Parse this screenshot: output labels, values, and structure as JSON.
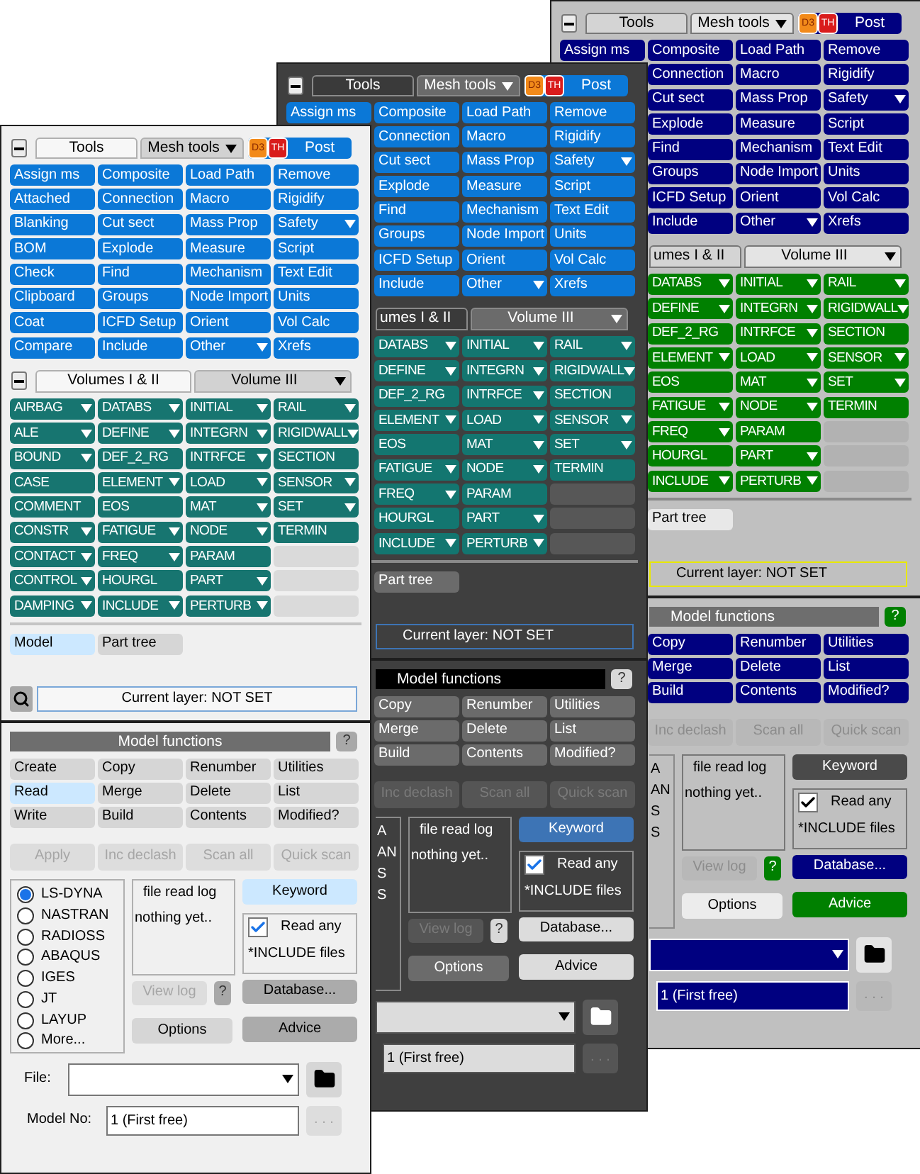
{
  "panels": [
    {
      "kind": "classic",
      "tabs": [
        {
          "label": "Tools",
          "selected": true,
          "menu": false
        },
        {
          "label": "Mesh tools",
          "selected": false,
          "menu": true
        }
      ],
      "logo": [
        "D3",
        "TH"
      ],
      "post": "Post",
      "tools": [
        [
          {
            "label": "Assign ms",
            "kind": "button"
          },
          {
            "label": "Composite",
            "kind": "button"
          },
          {
            "label": "Load Path",
            "kind": "button"
          },
          {
            "label": "Remove",
            "kind": "button"
          }
        ],
        [
          {
            "label": "Connection",
            "kind": "button"
          },
          {
            "label": "Macro",
            "kind": "button"
          },
          {
            "label": "Rigidify",
            "kind": "button"
          }
        ],
        [
          {
            "label": "Cut sect",
            "kind": "button"
          },
          {
            "label": "Mass Prop",
            "kind": "button"
          },
          {
            "label": "Safety",
            "kind": "menu"
          }
        ],
        [
          {
            "label": "Explode",
            "kind": "button"
          },
          {
            "label": "Measure",
            "kind": "button"
          },
          {
            "label": "Script",
            "kind": "button"
          }
        ],
        [
          {
            "label": "Find",
            "kind": "button"
          },
          {
            "label": "Mechanism",
            "kind": "button"
          },
          {
            "label": "Text Edit",
            "kind": "button"
          }
        ],
        [
          {
            "label": "Groups",
            "kind": "button"
          },
          {
            "label": "Node Import",
            "kind": "button"
          },
          {
            "label": "Units",
            "kind": "button"
          }
        ],
        [
          {
            "label": "ICFD Setup",
            "kind": "button"
          },
          {
            "label": "Orient",
            "kind": "button"
          },
          {
            "label": "Vol Calc",
            "kind": "button"
          }
        ],
        [
          {
            "label": "Include",
            "kind": "button"
          },
          {
            "label": "Other",
            "kind": "menu"
          },
          {
            "label": "Xrefs",
            "kind": "button"
          }
        ]
      ],
      "volume_tabs": [
        {
          "label": "umes I & II",
          "selected": true,
          "cut": true,
          "menu": false
        },
        {
          "label": "Volume III",
          "selected": false,
          "cut": false,
          "menu": true
        }
      ],
      "volumes": [
        [
          {
            "label": "DATABS",
            "kind": "menu"
          },
          {
            "label": "INITIAL",
            "kind": "menu"
          },
          {
            "label": "RAIL",
            "kind": "menu"
          }
        ],
        [
          {
            "label": "DEFINE",
            "kind": "menu"
          },
          {
            "label": "INTEGRN",
            "kind": "menu"
          },
          {
            "label": "RIGIDWALL",
            "kind": "menu"
          }
        ],
        [
          {
            "label": "DEF_2_RG",
            "kind": "button"
          },
          {
            "label": "INTRFCE",
            "kind": "menu"
          },
          {
            "label": "SECTION",
            "kind": "button"
          }
        ],
        [
          {
            "label": "ELEMENT",
            "kind": "menu"
          },
          {
            "label": "LOAD",
            "kind": "menu"
          },
          {
            "label": "SENSOR",
            "kind": "menu"
          }
        ],
        [
          {
            "label": "EOS",
            "kind": "button"
          },
          {
            "label": "MAT",
            "kind": "menu"
          },
          {
            "label": "SET",
            "kind": "menu"
          }
        ],
        [
          {
            "label": "FATIGUE",
            "kind": "menu"
          },
          {
            "label": "NODE",
            "kind": "menu"
          },
          {
            "label": "TERMIN",
            "kind": "button"
          }
        ],
        [
          {
            "label": "FREQ",
            "kind": "menu"
          },
          {
            "label": "PARAM",
            "kind": "button"
          },
          {
            "kind": "blank"
          }
        ],
        [
          {
            "label": "HOURGL",
            "kind": "button"
          },
          {
            "label": "PART",
            "kind": "menu"
          },
          {
            "kind": "blank"
          }
        ],
        [
          {
            "label": "INCLUDE",
            "kind": "menu"
          },
          {
            "label": "PERTURB",
            "kind": "menu"
          },
          {
            "kind": "blank"
          }
        ]
      ],
      "modes": [
        {
          "label": "Part tree",
          "selected": false
        }
      ],
      "layer": {
        "text": "Current layer: NOT SET"
      },
      "header": {
        "title": "Model functions",
        "help": "?"
      },
      "functions": [
        [
          {
            "label": "Copy",
            "selected": false
          },
          {
            "label": "Renumber",
            "selected": false
          },
          {
            "label": "Utilities",
            "selected": false
          }
        ],
        [
          {
            "label": "Merge",
            "selected": false
          },
          {
            "label": "Delete",
            "selected": false
          },
          {
            "label": "List",
            "selected": false
          }
        ],
        [
          {
            "label": "Build",
            "selected": false
          },
          {
            "label": "Contents",
            "selected": false
          },
          {
            "label": "Modified?",
            "selected": false
          }
        ]
      ],
      "actions": [
        {
          "label": "Inc declash",
          "disabled": true
        },
        {
          "label": "Scan all",
          "disabled": true
        },
        {
          "label": "Quick scan",
          "disabled": true
        }
      ],
      "formats": {
        "cut": true,
        "items": [
          {
            "label": "A"
          },
          {
            "label": "AN"
          },
          {
            "label": "S"
          },
          {
            "label": "S"
          }
        ]
      },
      "log": {
        "title": "file read log",
        "text": "nothing yet.."
      },
      "keyword": {
        "label": "Keyword",
        "selected": true
      },
      "read_any": {
        "checked": true,
        "label": "Read any",
        "note": "*INCLUDE files"
      },
      "view_log": {
        "label": "View log",
        "disabled": true
      },
      "log_help": "?",
      "database": "Database...",
      "options": "Options",
      "advice": "Advice",
      "model_no": {
        "value": "1 (First free)",
        "more": ". . ."
      }
    },
    {
      "kind": "dark",
      "tabs": [
        {
          "label": "Tools",
          "selected": true,
          "menu": false
        },
        {
          "label": "Mesh tools",
          "selected": false,
          "menu": true
        }
      ],
      "logo": [
        "D3",
        "TH"
      ],
      "post": "Post",
      "tools": [
        [
          {
            "label": "Assign ms",
            "kind": "button"
          },
          {
            "label": "Composite",
            "kind": "button"
          },
          {
            "label": "Load Path",
            "kind": "button"
          },
          {
            "label": "Remove",
            "kind": "button"
          }
        ],
        [
          {
            "label": "Connection",
            "kind": "button"
          },
          {
            "label": "Macro",
            "kind": "button"
          },
          {
            "label": "Rigidify",
            "kind": "button"
          }
        ],
        [
          {
            "label": "Cut sect",
            "kind": "button"
          },
          {
            "label": "Mass Prop",
            "kind": "button"
          },
          {
            "label": "Safety",
            "kind": "menu"
          }
        ],
        [
          {
            "label": "Explode",
            "kind": "button"
          },
          {
            "label": "Measure",
            "kind": "button"
          },
          {
            "label": "Script",
            "kind": "button"
          }
        ],
        [
          {
            "label": "Find",
            "kind": "button"
          },
          {
            "label": "Mechanism",
            "kind": "button"
          },
          {
            "label": "Text Edit",
            "kind": "button"
          }
        ],
        [
          {
            "label": "Groups",
            "kind": "button"
          },
          {
            "label": "Node Import",
            "kind": "button"
          },
          {
            "label": "Units",
            "kind": "button"
          }
        ],
        [
          {
            "label": "ICFD Setup",
            "kind": "button"
          },
          {
            "label": "Orient",
            "kind": "button"
          },
          {
            "label": "Vol Calc",
            "kind": "button"
          }
        ],
        [
          {
            "label": "Include",
            "kind": "button"
          },
          {
            "label": "Other",
            "kind": "menu"
          },
          {
            "label": "Xrefs",
            "kind": "button"
          }
        ]
      ],
      "volume_tabs": [
        {
          "label": "umes I & II",
          "selected": true,
          "cut": true,
          "menu": false
        },
        {
          "label": "Volume III",
          "selected": false,
          "cut": false,
          "menu": true
        }
      ],
      "volumes": [
        [
          {
            "label": "DATABS",
            "kind": "menu"
          },
          {
            "label": "INITIAL",
            "kind": "menu"
          },
          {
            "label": "RAIL",
            "kind": "menu"
          }
        ],
        [
          {
            "label": "DEFINE",
            "kind": "menu"
          },
          {
            "label": "INTEGRN",
            "kind": "menu"
          },
          {
            "label": "RIGIDWALL",
            "kind": "menu"
          }
        ],
        [
          {
            "label": "DEF_2_RG",
            "kind": "button"
          },
          {
            "label": "INTRFCE",
            "kind": "menu"
          },
          {
            "label": "SECTION",
            "kind": "button"
          }
        ],
        [
          {
            "label": "ELEMENT",
            "kind": "menu"
          },
          {
            "label": "LOAD",
            "kind": "menu"
          },
          {
            "label": "SENSOR",
            "kind": "menu"
          }
        ],
        [
          {
            "label": "EOS",
            "kind": "button"
          },
          {
            "label": "MAT",
            "kind": "menu"
          },
          {
            "label": "SET",
            "kind": "menu"
          }
        ],
        [
          {
            "label": "FATIGUE",
            "kind": "menu"
          },
          {
            "label": "NODE",
            "kind": "menu"
          },
          {
            "label": "TERMIN",
            "kind": "button"
          }
        ],
        [
          {
            "label": "FREQ",
            "kind": "menu"
          },
          {
            "label": "PARAM",
            "kind": "button"
          },
          {
            "kind": "blank"
          }
        ],
        [
          {
            "label": "HOURGL",
            "kind": "button"
          },
          {
            "label": "PART",
            "kind": "menu"
          },
          {
            "kind": "blank"
          }
        ],
        [
          {
            "label": "INCLUDE",
            "kind": "menu"
          },
          {
            "label": "PERTURB",
            "kind": "menu"
          },
          {
            "kind": "blank"
          }
        ]
      ],
      "modes": [
        {
          "label": "Part tree",
          "selected": false
        }
      ],
      "layer": {
        "text": "Current layer: NOT SET"
      },
      "header": {
        "title": "Model functions",
        "help": "?"
      },
      "functions": [
        [
          {
            "label": "Copy",
            "selected": false
          },
          {
            "label": "Renumber",
            "selected": false
          },
          {
            "label": "Utilities",
            "selected": false
          }
        ],
        [
          {
            "label": "Merge",
            "selected": false
          },
          {
            "label": "Delete",
            "selected": false
          },
          {
            "label": "List",
            "selected": false
          }
        ],
        [
          {
            "label": "Build",
            "selected": false
          },
          {
            "label": "Contents",
            "selected": false
          },
          {
            "label": "Modified?",
            "selected": false
          }
        ]
      ],
      "actions": [
        {
          "label": "Inc declash",
          "disabled": true
        },
        {
          "label": "Scan all",
          "disabled": true
        },
        {
          "label": "Quick scan",
          "disabled": true
        }
      ],
      "formats": {
        "cut": true,
        "items": [
          {
            "label": "A"
          },
          {
            "label": "AN"
          },
          {
            "label": "S"
          },
          {
            "label": "S"
          }
        ]
      },
      "log": {
        "title": "file read log",
        "text": "nothing yet.."
      },
      "keyword": {
        "label": "Keyword",
        "selected": true
      },
      "read_any": {
        "checked": true,
        "label": "Read any",
        "note": "*INCLUDE files"
      },
      "view_log": {
        "label": "View log",
        "disabled": true
      },
      "log_help": "?",
      "database": "Database...",
      "options": "Options",
      "advice": "Advice",
      "model_no": {
        "value": "1 (First free)",
        "more": ". . ."
      }
    },
    {
      "kind": "light",
      "tabs": [
        {
          "label": "Tools",
          "selected": true,
          "menu": false
        },
        {
          "label": "Mesh tools",
          "selected": false,
          "menu": true
        }
      ],
      "logo": [
        "D3",
        "TH"
      ],
      "post": "Post",
      "tools": [
        [
          {
            "label": "Assign ms",
            "kind": "button"
          },
          {
            "label": "Composite",
            "kind": "button"
          },
          {
            "label": "Load Path",
            "kind": "button"
          },
          {
            "label": "Remove",
            "kind": "button"
          }
        ],
        [
          {
            "label": "Attached",
            "kind": "button"
          },
          {
            "label": "Connection",
            "kind": "button"
          },
          {
            "label": "Macro",
            "kind": "button"
          },
          {
            "label": "Rigidify",
            "kind": "button"
          }
        ],
        [
          {
            "label": "Blanking",
            "kind": "button"
          },
          {
            "label": "Cut sect",
            "kind": "button"
          },
          {
            "label": "Mass Prop",
            "kind": "button"
          },
          {
            "label": "Safety",
            "kind": "menu"
          }
        ],
        [
          {
            "label": "BOM",
            "kind": "button"
          },
          {
            "label": "Explode",
            "kind": "button"
          },
          {
            "label": "Measure",
            "kind": "button"
          },
          {
            "label": "Script",
            "kind": "button"
          }
        ],
        [
          {
            "label": "Check",
            "kind": "button"
          },
          {
            "label": "Find",
            "kind": "button"
          },
          {
            "label": "Mechanism",
            "kind": "button"
          },
          {
            "label": "Text Edit",
            "kind": "button"
          }
        ],
        [
          {
            "label": "Clipboard",
            "kind": "button"
          },
          {
            "label": "Groups",
            "kind": "button"
          },
          {
            "label": "Node Import",
            "kind": "button"
          },
          {
            "label": "Units",
            "kind": "button"
          }
        ],
        [
          {
            "label": "Coat",
            "kind": "button"
          },
          {
            "label": "ICFD Setup",
            "kind": "button"
          },
          {
            "label": "Orient",
            "kind": "button"
          },
          {
            "label": "Vol Calc",
            "kind": "button"
          }
        ],
        [
          {
            "label": "Compare",
            "kind": "button"
          },
          {
            "label": "Include",
            "kind": "button"
          },
          {
            "label": "Other",
            "kind": "menu"
          },
          {
            "label": "Xrefs",
            "kind": "button"
          }
        ]
      ],
      "volumes_toggle": true,
      "volume_tabs": [
        {
          "label": "Volumes I & II",
          "selected": true,
          "cut": false,
          "menu": false
        },
        {
          "label": "Volume III",
          "selected": false,
          "cut": false,
          "menu": true
        }
      ],
      "volumes": [
        [
          {
            "label": "AIRBAG",
            "kind": "menu"
          },
          {
            "label": "DATABS",
            "kind": "menu"
          },
          {
            "label": "INITIAL",
            "kind": "menu"
          },
          {
            "label": "RAIL",
            "kind": "menu"
          }
        ],
        [
          {
            "label": "ALE",
            "kind": "menu"
          },
          {
            "label": "DEFINE",
            "kind": "menu"
          },
          {
            "label": "INTEGRN",
            "kind": "menu"
          },
          {
            "label": "RIGIDWALL",
            "kind": "menu"
          }
        ],
        [
          {
            "label": "BOUND",
            "kind": "menu"
          },
          {
            "label": "DEF_2_RG",
            "kind": "button"
          },
          {
            "label": "INTRFCE",
            "kind": "menu"
          },
          {
            "label": "SECTION",
            "kind": "button"
          }
        ],
        [
          {
            "label": "CASE",
            "kind": "button"
          },
          {
            "label": "ELEMENT",
            "kind": "menu"
          },
          {
            "label": "LOAD",
            "kind": "menu"
          },
          {
            "label": "SENSOR",
            "kind": "menu"
          }
        ],
        [
          {
            "label": "COMMENT",
            "kind": "button"
          },
          {
            "label": "EOS",
            "kind": "button"
          },
          {
            "label": "MAT",
            "kind": "menu"
          },
          {
            "label": "SET",
            "kind": "menu"
          }
        ],
        [
          {
            "label": "CONSTR",
            "kind": "menu"
          },
          {
            "label": "FATIGUE",
            "kind": "menu"
          },
          {
            "label": "NODE",
            "kind": "menu"
          },
          {
            "label": "TERMIN",
            "kind": "button"
          }
        ],
        [
          {
            "label": "CONTACT",
            "kind": "menu"
          },
          {
            "label": "FREQ",
            "kind": "menu"
          },
          {
            "label": "PARAM",
            "kind": "button"
          },
          {
            "kind": "blank"
          }
        ],
        [
          {
            "label": "CONTROL",
            "kind": "menu"
          },
          {
            "label": "HOURGL",
            "kind": "button"
          },
          {
            "label": "PART",
            "kind": "menu"
          },
          {
            "kind": "blank"
          }
        ],
        [
          {
            "label": "DAMPING",
            "kind": "menu"
          },
          {
            "label": "INCLUDE",
            "kind": "menu"
          },
          {
            "label": "PERTURB",
            "kind": "menu"
          },
          {
            "kind": "blank"
          }
        ]
      ],
      "modes": [
        {
          "label": "Model",
          "selected": true
        },
        {
          "label": "Part tree",
          "selected": false
        }
      ],
      "layer": {
        "text": "Current layer: NOT SET",
        "search": true
      },
      "header": {
        "title": "Model functions",
        "help": "?"
      },
      "functions": [
        [
          {
            "label": "Create",
            "selected": false
          },
          {
            "label": "Copy",
            "selected": false
          },
          {
            "label": "Renumber",
            "selected": false
          },
          {
            "label": "Utilities",
            "selected": false
          }
        ],
        [
          {
            "label": "Read",
            "selected": true
          },
          {
            "label": "Merge",
            "selected": false
          },
          {
            "label": "Delete",
            "selected": false
          },
          {
            "label": "List",
            "selected": false
          }
        ],
        [
          {
            "label": "Write",
            "selected": false
          },
          {
            "label": "Build",
            "selected": false
          },
          {
            "label": "Contents",
            "selected": false
          },
          {
            "label": "Modified?",
            "selected": false
          }
        ]
      ],
      "actions": [
        {
          "label": "Apply",
          "disabled": true
        },
        {
          "label": "Inc declash",
          "disabled": true
        },
        {
          "label": "Scan all",
          "disabled": true
        },
        {
          "label": "Quick scan",
          "disabled": true
        }
      ],
      "formats": {
        "cut": false,
        "items": [
          {
            "label": "LS-DYNA",
            "selected": true
          },
          {
            "label": "NASTRAN",
            "selected": false
          },
          {
            "label": "RADIOSS",
            "selected": false
          },
          {
            "label": "ABAQUS",
            "selected": false
          },
          {
            "label": "IGES",
            "selected": false
          },
          {
            "label": "JT",
            "selected": false
          },
          {
            "label": "LAYUP",
            "selected": false
          },
          {
            "label": "More...",
            "selected": false
          }
        ]
      },
      "log": {
        "title": "file read log",
        "text": "nothing yet.."
      },
      "keyword": {
        "label": "Keyword",
        "selected": true
      },
      "read_any": {
        "checked": true,
        "label": "Read any",
        "note": "*INCLUDE files"
      },
      "view_log": {
        "label": "View log",
        "disabled": true
      },
      "log_help": "?",
      "database": "Database...",
      "options": "Options",
      "advice": "Advice",
      "file_label": "File:",
      "model_no": {
        "label": "Model No:",
        "value": "1 (First free)",
        "more": ". . ."
      }
    }
  ]
}
